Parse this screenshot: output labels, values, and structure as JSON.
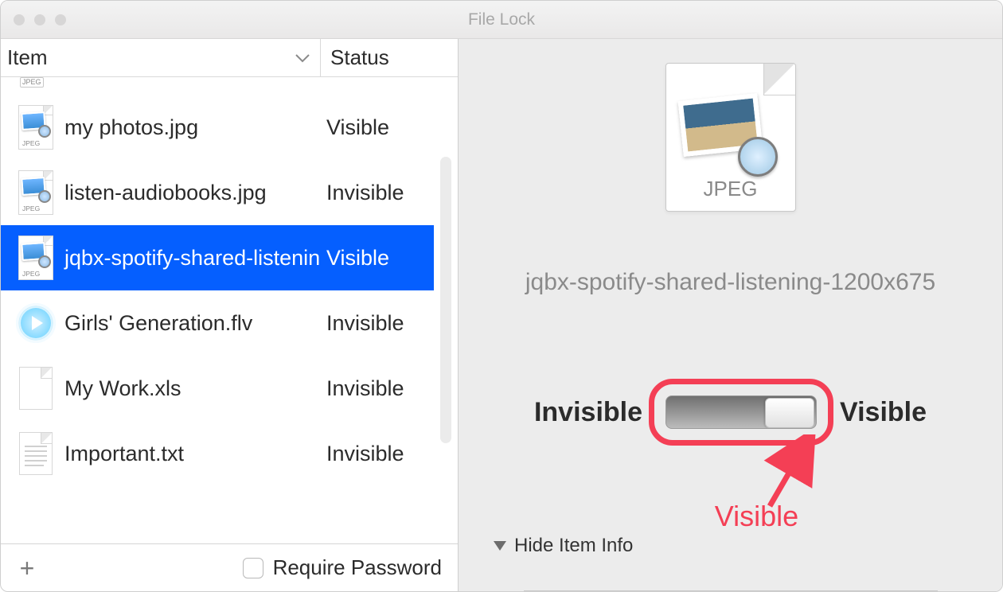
{
  "window": {
    "title": "File Lock"
  },
  "columns": {
    "item": "Item",
    "status": "Status"
  },
  "thumb_tag": "JPEG",
  "rows": [
    {
      "name": "my photos.jpg",
      "status": "Visible",
      "icon": "jpeg",
      "selected": false
    },
    {
      "name": "listen-audiobooks.jpg",
      "status": "Invisible",
      "icon": "jpeg",
      "selected": false
    },
    {
      "name": "jqbx-spotify-shared-listenin",
      "status": "Visible",
      "icon": "jpeg",
      "selected": true
    },
    {
      "name": "Girls' Generation.flv",
      "status": "Invisible",
      "icon": "flv",
      "selected": false
    },
    {
      "name": "My Work.xls",
      "status": "Invisible",
      "icon": "blank",
      "selected": false
    },
    {
      "name": "Important.txt",
      "status": "Invisible",
      "icon": "text",
      "selected": false
    }
  ],
  "bottom": {
    "require_password": "Require Password"
  },
  "preview": {
    "badge": "JPEG",
    "filename": "jqbx-spotify-shared-listening-1200x675",
    "left_label": "Invisible",
    "right_label": "Visible",
    "disclosure": "Hide Item Info",
    "annotation": "Visible"
  },
  "colors": {
    "selection": "#055fff",
    "callout": "#f43f55"
  }
}
